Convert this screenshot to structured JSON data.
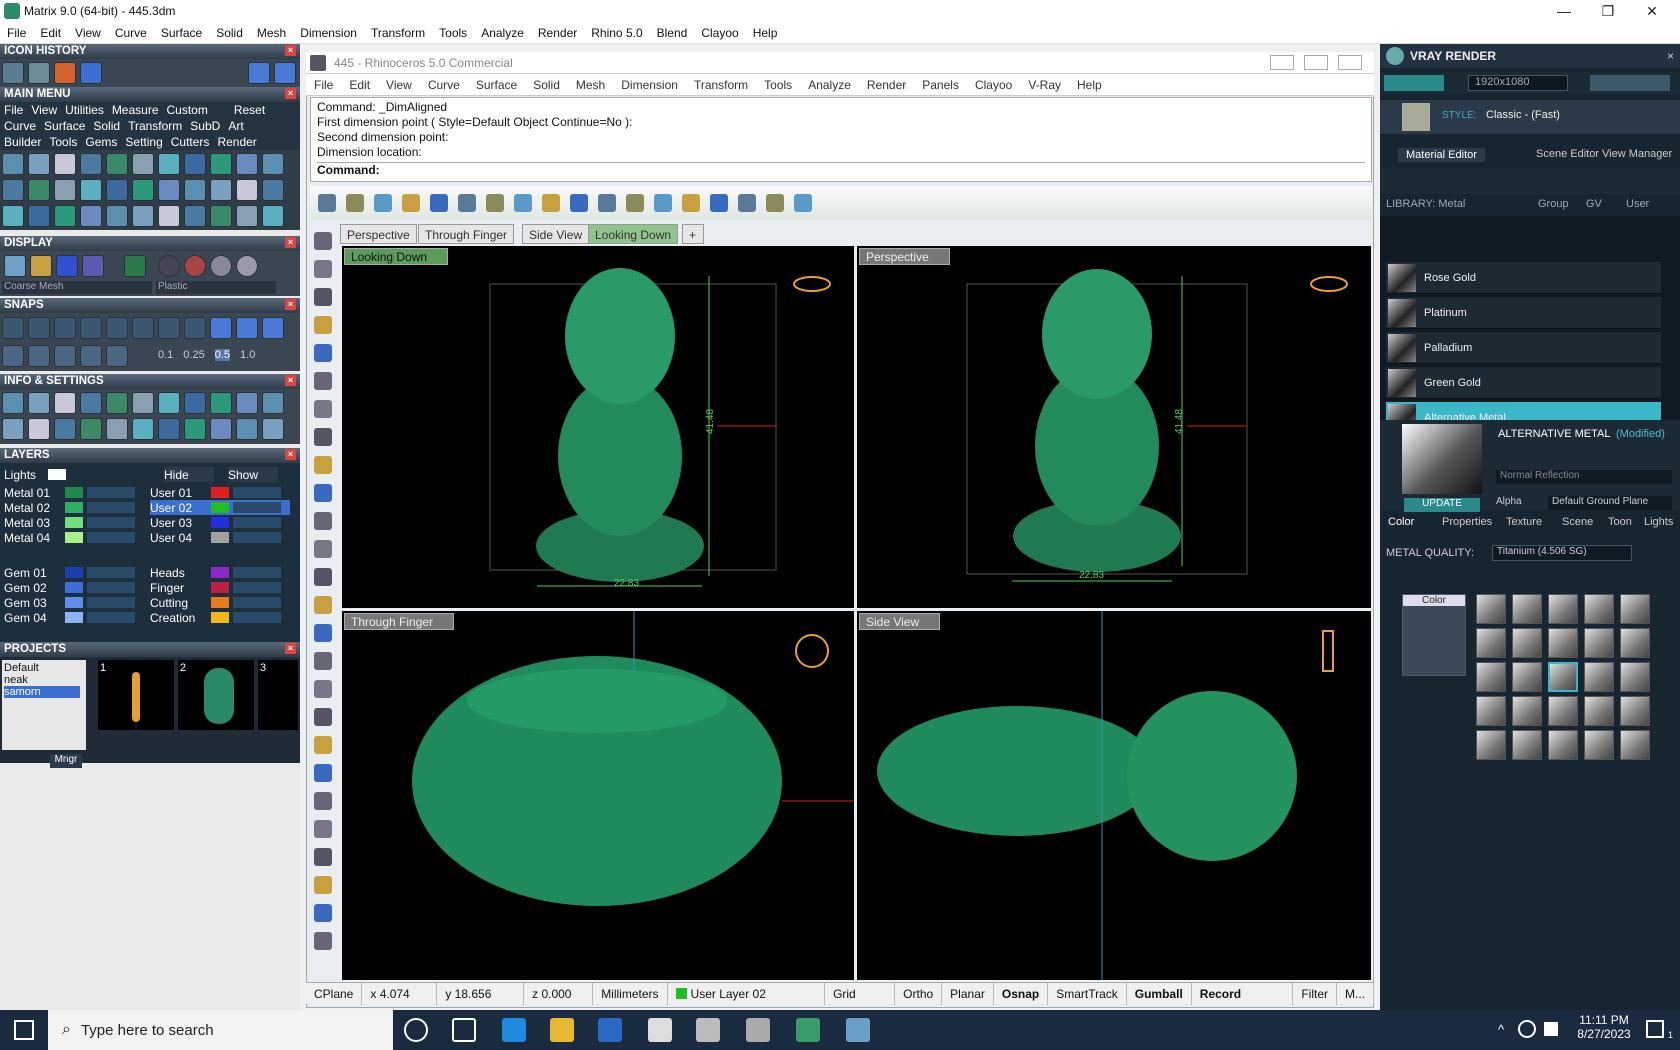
{
  "app": {
    "title": "Matrix 9.0 (64-bit) - 445.3dm",
    "controls": {
      "min": "—",
      "max": "❐",
      "close": "✕"
    }
  },
  "menu": [
    "File",
    "Edit",
    "View",
    "Curve",
    "Surface",
    "Solid",
    "Mesh",
    "Dimension",
    "Transform",
    "Tools",
    "Analyze",
    "Render",
    "Rhino 5.0",
    "Blend",
    "Clayoo",
    "Help"
  ],
  "left": {
    "icon_history": "ICON HISTORY",
    "main_menu": "MAIN MENU",
    "main_menu_items": [
      "File",
      "View",
      "Utilities",
      "Measure",
      "Custom",
      "Reset"
    ],
    "cat_row1": [
      "Curve",
      "Surface",
      "Solid",
      "Transform",
      "SubD",
      "Art"
    ],
    "cat_row2": [
      "Builder",
      "Tools",
      "Gems",
      "Setting",
      "Cutters",
      "Render"
    ],
    "display": "DISPLAY",
    "display_modes": [
      "Coarse Mesh",
      "Plastic"
    ],
    "snaps": "SNAPS",
    "snap_values": [
      "0.1",
      "0.25",
      "0.5",
      "1.0"
    ],
    "info": "INFO & SETTINGS",
    "layers": "LAYERS",
    "lights": "Lights",
    "hide": "Hide",
    "show": "Show",
    "layers_left": [
      {
        "name": "Metal 01",
        "color": "#1f8a4d"
      },
      {
        "name": "Metal 02",
        "color": "#2db062"
      },
      {
        "name": "Metal 03",
        "color": "#6ee07a"
      },
      {
        "name": "Metal 04",
        "color": "#a8f08a"
      },
      {
        "name": "Gem 01",
        "color": "#1a3fb0"
      },
      {
        "name": "Gem 02",
        "color": "#3a6ed8"
      },
      {
        "name": "Gem 03",
        "color": "#5a8ee8"
      },
      {
        "name": "Gem 04",
        "color": "#8ab4f4"
      }
    ],
    "layers_right": [
      {
        "name": "User 01",
        "color": "#e02020"
      },
      {
        "name": "User 02",
        "color": "#20c020"
      },
      {
        "name": "User 03",
        "color": "#2030e0"
      },
      {
        "name": "User 04",
        "color": "#a0a0a0"
      },
      {
        "name": "Heads",
        "color": "#8a28c8"
      },
      {
        "name": "Finger",
        "color": "#c02040"
      },
      {
        "name": "Cutting",
        "color": "#e87818"
      },
      {
        "name": "Creation",
        "color": "#f0b818"
      }
    ],
    "projects": "PROJECTS",
    "project_list": [
      "Default",
      "neak",
      "samorn"
    ],
    "thumbs": [
      "1",
      "2",
      "3"
    ],
    "mngr": "Mngr"
  },
  "doc": {
    "title": "445 - Rhinoceros 5.0 Commercial",
    "menu": [
      "File",
      "Edit",
      "View",
      "Curve",
      "Surface",
      "Solid",
      "Mesh",
      "Dimension",
      "Transform",
      "Tools",
      "Analyze",
      "Render",
      "Panels",
      "Clayoo",
      "V-Ray",
      "Help"
    ],
    "command_lines": [
      "Command: _DimAligned",
      "First dimension point ( Style=Default  Object  Continue=No ):",
      "Second dimension point:",
      "Dimension location:"
    ],
    "command_prompt": "Command:",
    "tabs": [
      "Perspective",
      "Through Finger",
      "Side View",
      "Looking Down"
    ],
    "viewports": [
      "Looking Down",
      "Perspective",
      "Through Finger",
      "Side View"
    ],
    "dims": [
      "22.83",
      "41.48"
    ],
    "status": [
      "CPlane",
      "x 4.074",
      "y 18.656",
      "z 0.000",
      "Millimeters",
      "User Layer 02",
      "Grid Snap",
      "Ortho",
      "Planar",
      "Osnap",
      "SmartTrack",
      "Gumball",
      "Record History",
      "Filter",
      "M..."
    ]
  },
  "right": {
    "title": "VRAY RENDER",
    "resolution": "1920x1080",
    "style_label": "STYLE:",
    "style_value": "Classic - (Fast)",
    "tabs": [
      "Material Editor",
      "Scene Editor",
      "View Manager"
    ],
    "library": "LIBRARY: Metal",
    "group": "Group",
    "gv": "GV",
    "user": "User",
    "materials": [
      "Rose Gold",
      "Platinum",
      "Palladium",
      "Green Gold",
      "Alternative Metal"
    ],
    "material_name": "ALTERNATIVE METAL",
    "modified": "(Modified)",
    "reflection": "Normal Reflection",
    "update": "UPDATE",
    "alpha": "Alpha",
    "ground": "Default Ground Plane",
    "subtabs": [
      "Color",
      "Properties",
      "Texture",
      "Scene",
      "Toon",
      "Lights"
    ],
    "quality_label": "METAL QUALITY:",
    "quality_value": "Titanium    (4.506 SG)",
    "color_label": "Color"
  },
  "taskbar": {
    "search": "Type here to search",
    "time": "11:11 PM",
    "date": "8/27/2023",
    "badge": "1"
  }
}
